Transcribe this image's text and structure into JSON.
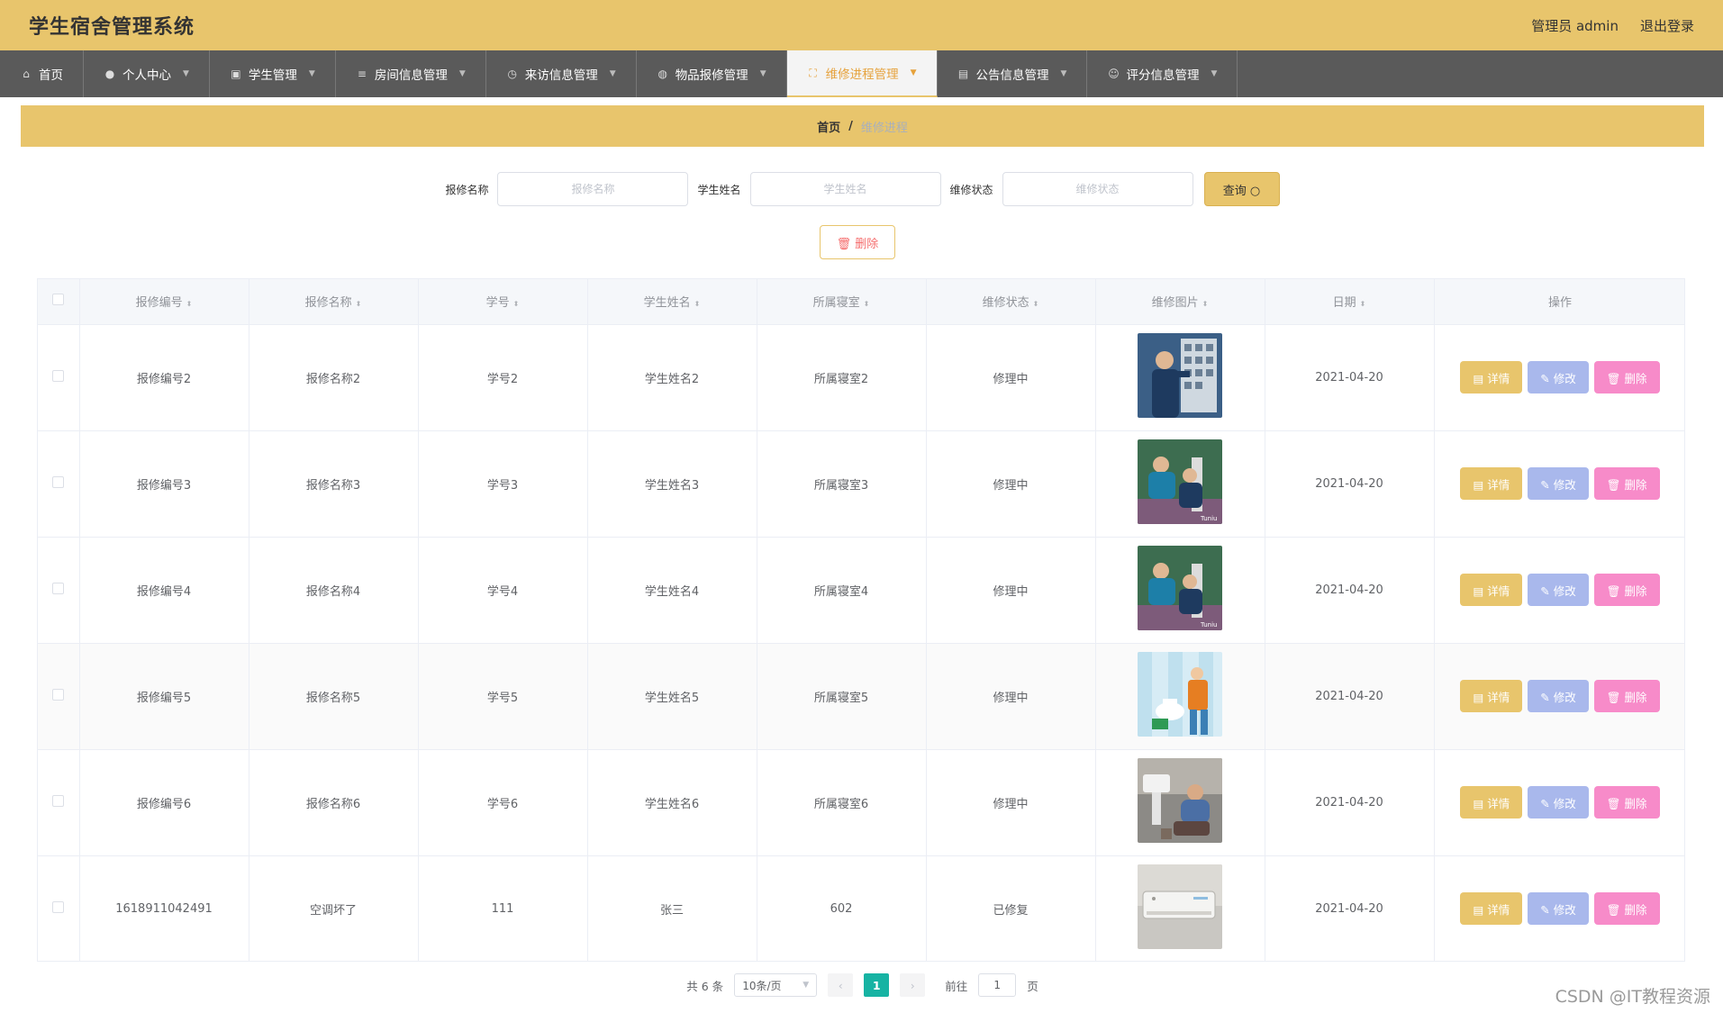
{
  "app": {
    "title": "学生宿舍管理系统",
    "admin_label": "管理员 admin",
    "logout_label": "退出登录"
  },
  "nav": [
    {
      "label": "首页",
      "icon": "home-icon",
      "glyph": "⌂",
      "caret": false,
      "active": false
    },
    {
      "label": "个人中心",
      "icon": "user-icon",
      "glyph": "●",
      "caret": true,
      "active": false
    },
    {
      "label": "学生管理",
      "icon": "picture-icon",
      "glyph": "▣",
      "caret": true,
      "active": false
    },
    {
      "label": "房间信息管理",
      "icon": "menu-icon",
      "glyph": "≡",
      "caret": true,
      "active": false
    },
    {
      "label": "来访信息管理",
      "icon": "compass-icon",
      "glyph": "◷",
      "caret": true,
      "active": false
    },
    {
      "label": "物品报修管理",
      "icon": "basketball-icon",
      "glyph": "◍",
      "caret": true,
      "active": false
    },
    {
      "label": "维修进程管理",
      "icon": "fullscreen-icon",
      "glyph": "⛶",
      "caret": true,
      "active": true
    },
    {
      "label": "公告信息管理",
      "icon": "clipboard-icon",
      "glyph": "▤",
      "caret": true,
      "active": false
    },
    {
      "label": "评分信息管理",
      "icon": "smile-icon",
      "glyph": "☺",
      "caret": true,
      "active": false
    }
  ],
  "breadcrumb": {
    "home": "首页",
    "separator": "/",
    "current": "维修进程"
  },
  "search": {
    "fields": [
      {
        "label": "报修名称",
        "placeholder": "报修名称"
      },
      {
        "label": "学生姓名",
        "placeholder": "学生姓名"
      },
      {
        "label": "维修状态",
        "placeholder": "维修状态"
      }
    ],
    "button_label": "查询 ○"
  },
  "bulk_delete_label": "🗑 删除",
  "table": {
    "columns": [
      "报修编号",
      "报修名称",
      "学号",
      "学生姓名",
      "所属寝室",
      "维修状态",
      "维修图片",
      "日期",
      "操作"
    ],
    "sort_glyph": "⬍",
    "rows": [
      {
        "id": "报修编号2",
        "name": "报修名称2",
        "student_no": "学号2",
        "student_name": "学生姓名2",
        "dorm": "所属寝室2",
        "status": "修理中",
        "image": "electrician-panel-photo",
        "date": "2021-04-20"
      },
      {
        "id": "报修编号3",
        "name": "报修名称3",
        "student_no": "学号3",
        "student_name": "学生姓名3",
        "dorm": "所属寝室3",
        "status": "修理中",
        "image": "workers-outdoor-photo",
        "date": "2021-04-20"
      },
      {
        "id": "报修编号4",
        "name": "报修名称4",
        "student_no": "学号4",
        "student_name": "学生姓名4",
        "dorm": "所属寝室4",
        "status": "修理中",
        "image": "workers-outdoor-photo",
        "date": "2021-04-20"
      },
      {
        "id": "报修编号5",
        "name": "报修名称5",
        "student_no": "学号5",
        "student_name": "学生姓名5",
        "dorm": "所属寝室5",
        "status": "修理中",
        "image": "plumber-illustration",
        "date": "2021-04-20"
      },
      {
        "id": "报修编号6",
        "name": "报修名称6",
        "student_no": "学号6",
        "student_name": "学生姓名6",
        "dorm": "所属寝室6",
        "status": "修理中",
        "image": "plumber-sink-photo",
        "date": "2021-04-20"
      },
      {
        "id": "1618911042491",
        "name": "空调坏了",
        "student_no": "111",
        "student_name": "张三",
        "dorm": "602",
        "status": "已修复",
        "image": "air-conditioner-photo",
        "date": "2021-04-20"
      }
    ],
    "actions": {
      "detail": "▤ 详情",
      "edit": "✎ 修改",
      "delete": "🗑 删除"
    }
  },
  "pagination": {
    "total_label": "共 6 条",
    "page_size_label": "10条/页",
    "prev_glyph": "‹",
    "current_page": "1",
    "next_glyph": "›",
    "goto_label": "前往",
    "goto_value": "1",
    "page_suffix": "页"
  },
  "watermark": "CSDN @IT教程资源",
  "colors": {
    "accent": "#e8c56c",
    "nav_bg": "#5a5a5a",
    "active_page": "#17b3a3",
    "edit": "#a9b8ec",
    "delete": "#f78bc9"
  }
}
